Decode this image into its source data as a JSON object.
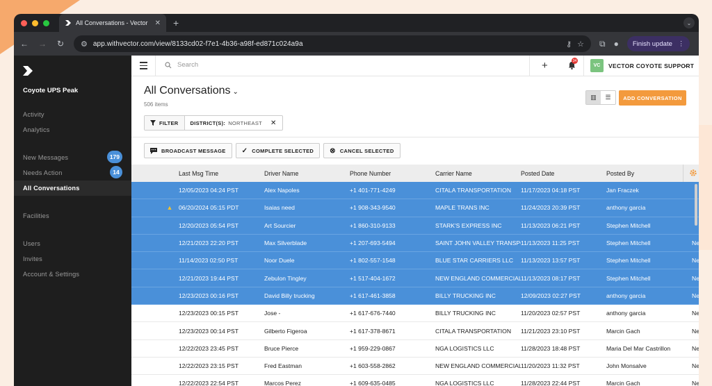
{
  "browser": {
    "tab_title": "All Conversations - Vector",
    "url": "app.withvector.com/view/8133cd02-f7e1-4b36-a98f-ed871c024a9a",
    "finish_update_label": "Finish update"
  },
  "sidebar": {
    "org_name": "Coyote UPS Peak",
    "items": [
      {
        "label": "Activity"
      },
      {
        "label": "Analytics"
      },
      {
        "label": "New Messages",
        "badge": "179"
      },
      {
        "label": "Needs Action",
        "badge": "14"
      },
      {
        "label": "All Conversations"
      },
      {
        "label": "Facilities"
      },
      {
        "label": "Users"
      },
      {
        "label": "Invites"
      },
      {
        "label": "Account & Settings"
      }
    ]
  },
  "topbar": {
    "search_placeholder": "Search",
    "notification_count": "34",
    "avatar_initials": "VC",
    "user_name": "VECTOR COYOTE SUPPORT"
  },
  "page": {
    "title": "All Conversations",
    "item_count": "506 items",
    "add_button": "ADD CONVERSATION",
    "filter_label": "FILTER",
    "filter_key": "DISTRICT(S):",
    "filter_value": "NORTHEAST"
  },
  "actions": {
    "broadcast": "BROADCAST MESSAGE",
    "complete": "COMPLETE SELECTED",
    "cancel": "CANCEL SELECTED"
  },
  "table": {
    "columns": [
      "Last Msg Time",
      "Driver Name",
      "Phone Number",
      "Carrier Name",
      "Posted Date",
      "Posted By"
    ],
    "rows": [
      {
        "selected": true,
        "warn": false,
        "time": "12/05/2023 04:24 PST",
        "driver": "Alex Napoles",
        "phone": "+1 401-771-4249",
        "carrier": "CITALA TRANSPORTATION",
        "posted": "11/17/2023 04:18 PST",
        "by": "Jan Fraczek",
        "extra": ""
      },
      {
        "selected": true,
        "warn": true,
        "time": "06/20/2024 05:15 PDT",
        "driver": "Isaias need",
        "phone": "+1 908-343-9540",
        "carrier": "MAPLE TRANS INC",
        "posted": "11/24/2023 20:39 PST",
        "by": "anthony garcia",
        "extra": ""
      },
      {
        "selected": true,
        "warn": false,
        "time": "12/20/2023 05:54 PST",
        "driver": "Art Sourcier",
        "phone": "+1 860-310-9133",
        "carrier": "STARK'S EXPRESS INC",
        "posted": "11/13/2023 06:21 PST",
        "by": "Stephen Mitchell",
        "extra": ""
      },
      {
        "selected": true,
        "warn": false,
        "time": "12/21/2023 22:20 PST",
        "driver": "Max Silverblade",
        "phone": "+1 207-693-5494",
        "carrier": "SAINT JOHN VALLEY TRANSPORT",
        "posted": "11/13/2023 11:25 PST",
        "by": "Stephen Mitchell",
        "extra": "Ne"
      },
      {
        "selected": true,
        "warn": false,
        "time": "11/14/2023 02:50 PST",
        "driver": "Noor Duele",
        "phone": "+1 802-557-1548",
        "carrier": "BLUE STAR CARRIERS LLC",
        "posted": "11/13/2023 13:57 PST",
        "by": "Stephen Mitchell",
        "extra": "Ne"
      },
      {
        "selected": true,
        "warn": false,
        "time": "12/21/2023 19:44 PST",
        "driver": "Zebulon Tingley",
        "phone": "+1 517-404-1672",
        "carrier": "NEW ENGLAND COMMERCIAL",
        "posted": "11/13/2023 08:17 PST",
        "by": "Stephen Mitchell",
        "extra": "Ne"
      },
      {
        "selected": true,
        "warn": false,
        "time": "12/23/2023 00:16 PST",
        "driver": "David Billy trucking",
        "phone": "+1 617-461-3858",
        "carrier": "BILLY TRUCKING INC",
        "posted": "12/09/2023 02:27 PST",
        "by": "anthony garcia",
        "extra": "Ne"
      },
      {
        "selected": false,
        "warn": false,
        "time": "12/23/2023 00:15 PST",
        "driver": "Jose -",
        "phone": "+1 617-676-7440",
        "carrier": "BILLY TRUCKING INC",
        "posted": "11/20/2023 02:57 PST",
        "by": "anthony garcia",
        "extra": "Ne"
      },
      {
        "selected": false,
        "warn": false,
        "time": "12/23/2023 00:14 PST",
        "driver": "Gilberto Figeroa",
        "phone": "+1 617-378-8671",
        "carrier": "CITALA TRANSPORTATION",
        "posted": "11/21/2023 23:10 PST",
        "by": "Marcin Gach",
        "extra": "Ne"
      },
      {
        "selected": false,
        "warn": false,
        "time": "12/22/2023 23:45 PST",
        "driver": "Bruce Pierce",
        "phone": "+1 959-229-0867",
        "carrier": "NGA LOGISTICS LLC",
        "posted": "11/28/2023 18:48 PST",
        "by": "Maria Del Mar Castrillon",
        "extra": "Ne"
      },
      {
        "selected": false,
        "warn": false,
        "time": "12/22/2023 23:15 PST",
        "driver": "Fred Eastman",
        "phone": "+1 603-558-2862",
        "carrier": "NEW ENGLAND COMMERCIAL",
        "posted": "11/20/2023 11:32 PST",
        "by": "John Monsalve",
        "extra": "Ne"
      },
      {
        "selected": false,
        "warn": false,
        "time": "12/22/2023 22:54 PST",
        "driver": "Marcos Perez",
        "phone": "+1 609-635-0485",
        "carrier": "NGA LOGISTICS LLC",
        "posted": "11/28/2023 22:44 PST",
        "by": "Marcin Gach",
        "extra": "Ne"
      }
    ]
  },
  "colors": {
    "accent_orange": "#f39a3d",
    "selection_blue": "#4a90d9",
    "sidebar_bg": "#1e1e1e"
  }
}
